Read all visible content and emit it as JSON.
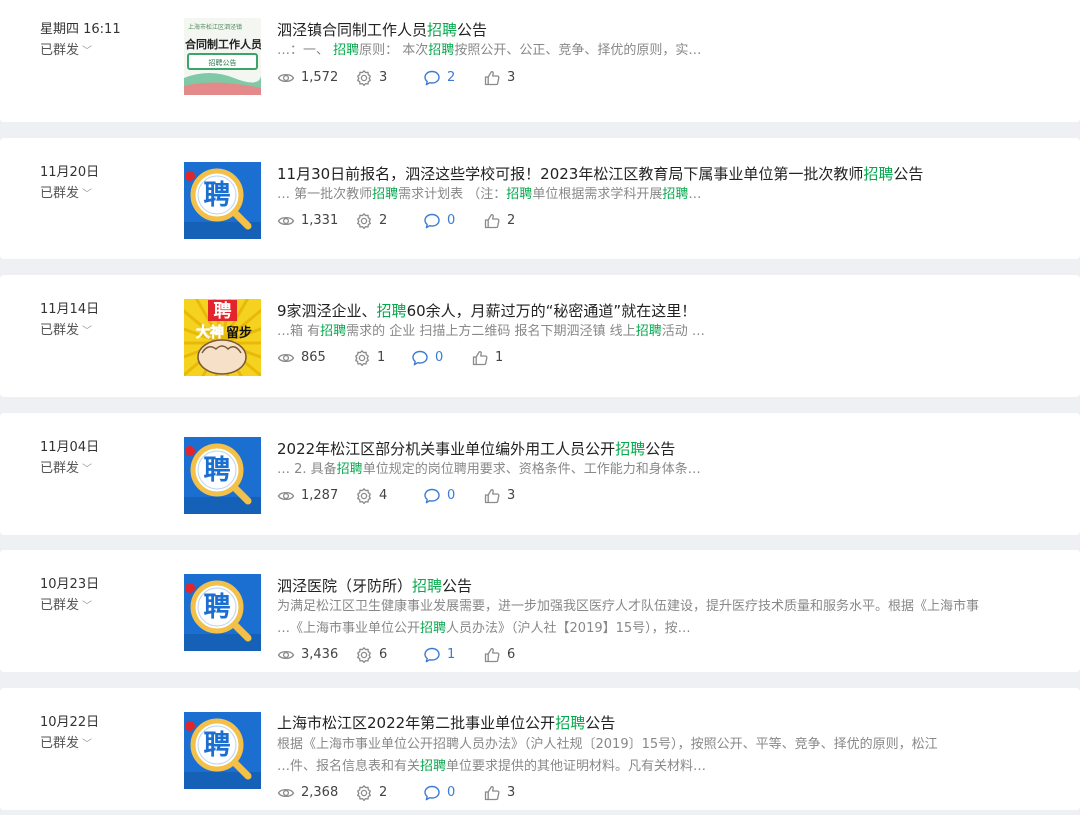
{
  "items": [
    {
      "date": "星期四 16:11",
      "status": "已群发",
      "thumb": {
        "type": "banner",
        "org": "上海市松江区泗泾镇",
        "text": "合同制工作人员",
        "tag": "招聘公告"
      },
      "title": [
        {
          "t": "泗泾镇合同制工作人员"
        },
        {
          "t": "招聘",
          "hl": true
        },
        {
          "t": "公告"
        }
      ],
      "snippet": [
        [
          {
            "t": "…：一、 "
          },
          {
            "t": "招聘",
            "hl": true
          },
          {
            "t": "原则： 本次"
          },
          {
            "t": "招聘",
            "hl": true
          },
          {
            "t": "按照公开、公正、竞争、择优的原则，实…"
          }
        ]
      ],
      "stats": {
        "views": "1,572",
        "shares": "3",
        "comments": "2",
        "likes": "3"
      }
    },
    {
      "date": "11月20日",
      "status": "已群发",
      "thumb": {
        "type": "pin",
        "text": "聘"
      },
      "title": [
        {
          "t": "11月30日前报名，泗泾这些学校可报！2023年松江区教育局下属事业单位第一批次教师"
        },
        {
          "t": "招聘",
          "hl": true
        },
        {
          "t": "公告"
        }
      ],
      "snippet": [
        [
          {
            "t": "… 第一批次教师"
          },
          {
            "t": "招聘",
            "hl": true
          },
          {
            "t": "需求计划表 （注："
          },
          {
            "t": "招聘",
            "hl": true
          },
          {
            "t": "单位根据需求学科开展"
          },
          {
            "t": "招聘",
            "hl": true
          },
          {
            "t": "…"
          }
        ]
      ],
      "stats": {
        "views": "1,331",
        "shares": "2",
        "comments": "0",
        "likes": "2"
      }
    },
    {
      "date": "11月14日",
      "status": "已群发",
      "thumb": {
        "type": "fist",
        "top": "聘",
        "line1": "大神",
        "line2": "留步"
      },
      "title": [
        {
          "t": "9家泗泾企业、"
        },
        {
          "t": "招聘",
          "hl": true
        },
        {
          "t": "60余人，月薪过万的“秘密通道”就在这里！"
        }
      ],
      "snippet": [
        [
          {
            "t": "…箱 有"
          },
          {
            "t": "招聘",
            "hl": true
          },
          {
            "t": "需求的 企业 扫描上方二维码 报名下期泗泾镇 线上"
          },
          {
            "t": "招聘",
            "hl": true
          },
          {
            "t": "活动 …"
          }
        ]
      ],
      "stats": {
        "views": "865",
        "shares": "1",
        "comments": "0",
        "likes": "1"
      }
    },
    {
      "date": "11月04日",
      "status": "已群发",
      "thumb": {
        "type": "pin",
        "text": "聘"
      },
      "title": [
        {
          "t": "2022年松江区部分机关事业单位编外用工人员公开"
        },
        {
          "t": "招聘",
          "hl": true
        },
        {
          "t": "公告"
        }
      ],
      "snippet": [
        [
          {
            "t": "… 2. 具备"
          },
          {
            "t": "招聘",
            "hl": true
          },
          {
            "t": "单位规定的岗位聘用要求、资格条件、工作能力和身体条…"
          }
        ]
      ],
      "stats": {
        "views": "1,287",
        "shares": "4",
        "comments": "0",
        "likes": "3"
      }
    },
    {
      "date": "10月23日",
      "status": "已群发",
      "thumb": {
        "type": "pin",
        "text": "聘"
      },
      "title": [
        {
          "t": "泗泾医院（牙防所）"
        },
        {
          "t": "招聘",
          "hl": true
        },
        {
          "t": "公告"
        }
      ],
      "snippet": [
        [
          {
            "t": "为满足松江区卫生健康事业发展需要，进一步加强我区医疗人才队伍建设，提升医疗技术质量和服务水平。根据《上海市事"
          }
        ],
        [
          {
            "t": "…《上海市事业单位公开"
          },
          {
            "t": "招聘",
            "hl": true
          },
          {
            "t": "人员办法》（沪人社【2019】15号），按…"
          }
        ]
      ],
      "stats": {
        "views": "3,436",
        "shares": "6",
        "comments": "1",
        "likes": "6"
      }
    },
    {
      "date": "10月22日",
      "status": "已群发",
      "thumb": {
        "type": "pin",
        "text": "聘"
      },
      "title": [
        {
          "t": "上海市松江区2022年第二批事业单位公开"
        },
        {
          "t": "招聘",
          "hl": true
        },
        {
          "t": "公告"
        }
      ],
      "snippet": [
        [
          {
            "t": "根据《上海市事业单位公开招聘人员办法》（沪人社规〔2019〕15号），按照公开、平等、竞争、择优的原则，松江"
          }
        ],
        [
          {
            "t": "…件、报名信息表和有关"
          },
          {
            "t": "招聘",
            "hl": true
          },
          {
            "t": "单位要求提供的其他证明材料。凡有关材料…"
          }
        ]
      ],
      "stats": {
        "views": "2,368",
        "shares": "2",
        "comments": "0",
        "likes": "3"
      }
    }
  ],
  "colors": {
    "highlight": "#07a94d",
    "thumb_blue": "#1a6fd1",
    "pin_yellow": "#f3c14a",
    "pin_red": "#e3242b",
    "fist_bg": "#f5d21f"
  },
  "icons": {
    "views": "eye-icon",
    "shares": "share-gear-icon",
    "comments": "comment-icon",
    "likes": "thumbs-up-icon",
    "status": "chevron-down-icon"
  }
}
